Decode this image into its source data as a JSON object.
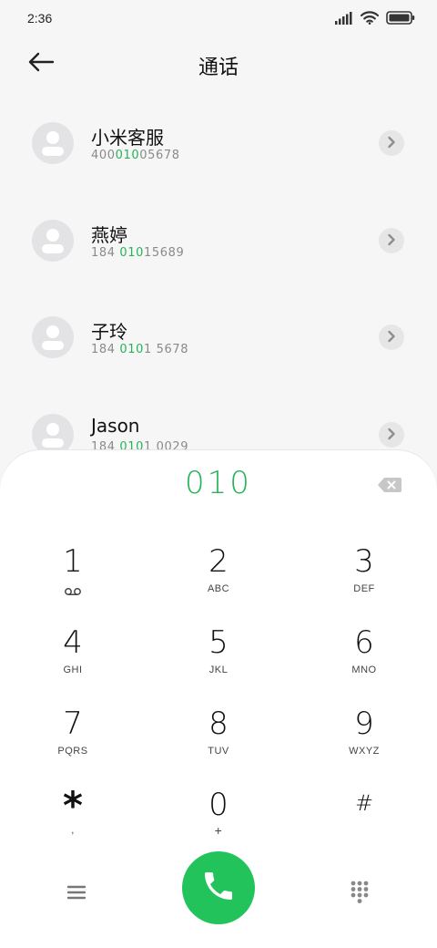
{
  "status_bar": {
    "time": "2:36",
    "icons": [
      "signal-icon",
      "wifi-icon",
      "battery-icon"
    ]
  },
  "header": {
    "title": "通话",
    "back_icon": "arrow-left-icon"
  },
  "contacts": [
    {
      "name": "小米客服",
      "number_parts": [
        "400",
        "010",
        "05678"
      ]
    },
    {
      "name": "燕婷",
      "number_parts": [
        "184 ",
        "010",
        "15689"
      ]
    },
    {
      "name": "子玲",
      "number_parts": [
        "184 ",
        "010",
        "1 5678"
      ]
    },
    {
      "name": "Jason",
      "number_parts": [
        "184 ",
        "010",
        "1 0029"
      ]
    }
  ],
  "dialer": {
    "input_value": "010",
    "keys": [
      {
        "digit": "1",
        "letters": ""
      },
      {
        "digit": "2",
        "letters": "ABC"
      },
      {
        "digit": "3",
        "letters": "DEF"
      },
      {
        "digit": "4",
        "letters": "GHI"
      },
      {
        "digit": "5",
        "letters": "JKL"
      },
      {
        "digit": "6",
        "letters": "MNO"
      },
      {
        "digit": "7",
        "letters": "PQRS"
      },
      {
        "digit": "8",
        "letters": "TUV"
      },
      {
        "digit": "9",
        "letters": "WXYZ"
      },
      {
        "digit": "*",
        "letters": ","
      },
      {
        "digit": "0",
        "letters": "+"
      },
      {
        "digit": "#",
        "letters": ""
      }
    ]
  },
  "colors": {
    "accent": "#27b25a",
    "call_button": "#22c35b",
    "avatar_bg": "#e3e3e6",
    "background": "#f6f6f6"
  }
}
